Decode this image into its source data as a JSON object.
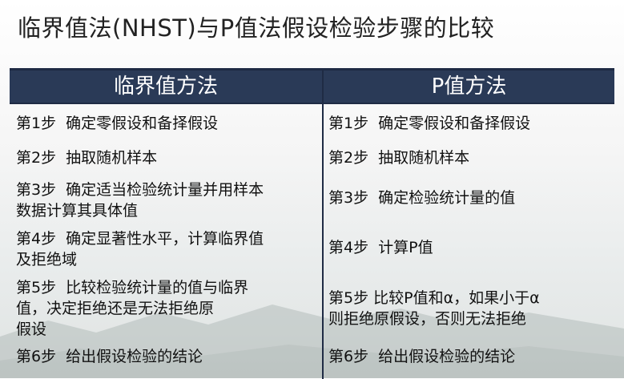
{
  "title": "临界值法(NHST)与P值法假设检验步骤的比较",
  "chart_data": {
    "type": "table",
    "columns": [
      "临界值方法",
      "P值方法"
    ],
    "rows": [
      [
        "第1步  确定零假设和备择假设",
        "第1步  确定零假设和备择假设"
      ],
      [
        "第2步  抽取随机样本",
        "第2步  抽取随机样本"
      ],
      [
        "第3步  确定适当检验统计量并用样本\n数据计算其具体值",
        "第3步  确定检验统计量的值"
      ],
      [
        "第4步  确定显著性水平，计算临界值\n及拒绝域",
        "第4步  计算P值"
      ],
      [
        "第5步  比较检验统计量的值与临界\n值，决定拒绝还是无法拒绝原\n假设",
        "第5步 比较P值和α，如果小于α\n则拒绝原假设，否则无法拒绝"
      ],
      [
        "第6步  给出假设检验的结论",
        "第6步  给出假设检验的结论"
      ]
    ]
  }
}
